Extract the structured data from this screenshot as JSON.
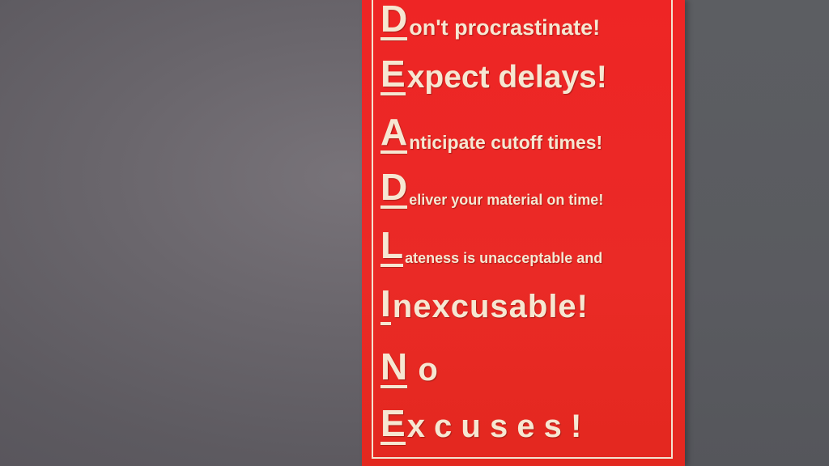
{
  "scene": {
    "description_colors": {
      "wall": "#6a666c",
      "poster_red": "#ec2825",
      "lettering": "#f6e7d2"
    }
  },
  "poster": {
    "lines": [
      {
        "initial": "D",
        "rest": "on't procrastinate!"
      },
      {
        "initial": "E",
        "rest": "xpect delays!"
      },
      {
        "initial": "A",
        "rest": "nticipate cutoff times!"
      },
      {
        "initial": "D",
        "rest": "eliver your material on time!"
      },
      {
        "initial": "L",
        "rest": "ateness is unacceptable and"
      },
      {
        "initial": "I",
        "rest": "nexcusable!"
      },
      {
        "initial": "N",
        "rest": " o"
      },
      {
        "initial": "E",
        "rest": "x c u s e s !"
      }
    ]
  }
}
